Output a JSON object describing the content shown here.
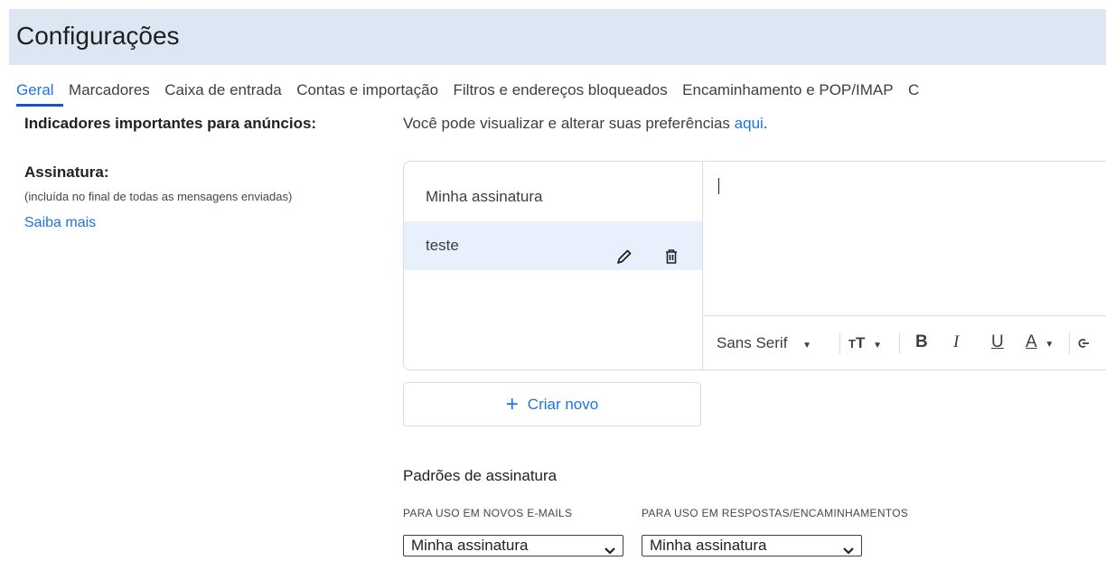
{
  "header": {
    "title": "Configurações"
  },
  "tabs": [
    {
      "label": "Geral",
      "active": true
    },
    {
      "label": "Marcadores",
      "active": false
    },
    {
      "label": "Caixa de entrada",
      "active": false
    },
    {
      "label": "Contas e importação",
      "active": false
    },
    {
      "label": "Filtros e endereços bloqueados",
      "active": false
    },
    {
      "label": "Encaminhamento e POP/IMAP",
      "active": false
    },
    {
      "label": "C",
      "active": false
    }
  ],
  "ads": {
    "label": "Indicadores importantes para anúncios:",
    "text": "Você pode visualizar e alterar suas preferências ",
    "link": "aqui",
    "suffix": "."
  },
  "signature": {
    "label": "Assinatura:",
    "hint": "(incluída no final de todas as mensagens enviadas)",
    "learn_more": "Saiba mais",
    "items": [
      {
        "name": "Minha assinatura",
        "selected": false
      },
      {
        "name": "teste",
        "selected": true
      }
    ],
    "create_label": "Criar novo",
    "icons": {
      "edit": "pencil-icon",
      "delete": "trash-icon",
      "create": "plus-icon"
    }
  },
  "toolbar": {
    "font_name": "Sans Serif",
    "size_icon": "text-size-icon",
    "bold": "B",
    "italic": "I",
    "underline": "U",
    "text_color": "A",
    "link_icon": "link-icon"
  },
  "defaults": {
    "title": "Padrões de assinatura",
    "new_label": "PARA USO EM NOVOS E-MAILS",
    "reply_label": "PARA USO EM RESPOSTAS/ENCAMINHAMENTOS",
    "new_value": "Minha assinatura",
    "reply_value": "Minha assinatura"
  },
  "colors": {
    "accent": "#1a73e8",
    "header_bg": "#dde7f4",
    "selected_bg": "#e8f0fe"
  }
}
